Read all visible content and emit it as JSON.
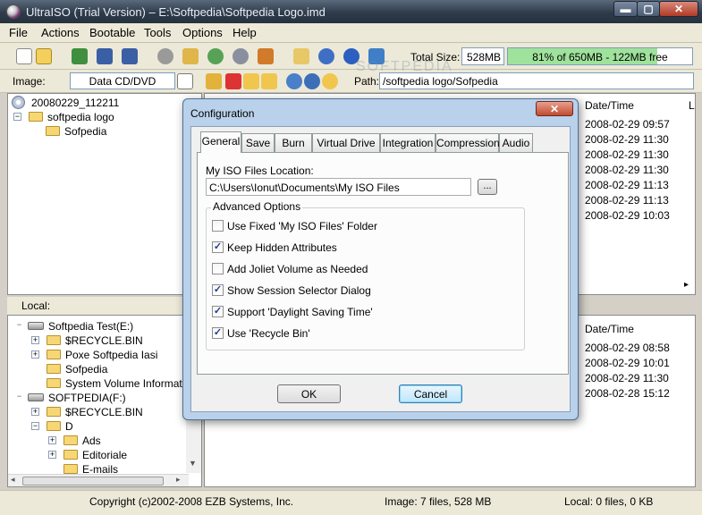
{
  "window": {
    "title": "UltraISO (Trial Version) – E:\\Softpedia\\Softpedia Logo.imd",
    "buttons": {
      "minimize": "▬",
      "maximize": "▢",
      "close": "✕"
    }
  },
  "menu": [
    "File",
    "Actions",
    "Bootable",
    "Tools",
    "Options",
    "Help"
  ],
  "toolbar": {
    "total_size_label": "Total Size:",
    "total_size_value": "528MB",
    "capacity_text": "81% of 650MB - 122MB free",
    "capacity_fraction": 0.81,
    "icons": [
      "new-icon",
      "open-icon",
      "extract-icon",
      "save-icon",
      "save-as-icon",
      "mount-icon",
      "burn-icon",
      "compress-icon",
      "virtual-drive-icon",
      "convert-icon",
      "properties-icon",
      "info-icon",
      "help-icon",
      "exit-icon"
    ]
  },
  "image_bar": {
    "image_label": "Image:",
    "image_type": "Data CD/DVD",
    "path_label": "Path:",
    "path_value": "/softpedia logo/Sofpedia"
  },
  "iso_tree": [
    "20080229_112211",
    "softpedia logo",
    "Sofpedia"
  ],
  "iso_list": {
    "header": "Date/Time",
    "header_extra": "L",
    "dates": [
      "2008-02-29 09:57",
      "2008-02-29 11:30",
      "2008-02-29 11:30",
      "2008-02-29 11:30",
      "2008-02-29 11:13",
      "2008-02-29 11:13",
      "2008-02-29 10:03"
    ]
  },
  "local": {
    "label": "Local:",
    "tree": [
      "Softpedia Test(E:)",
      "$RECYCLE.BIN",
      "Poxe Softpedia Iasi",
      "Sofpedia",
      "System Volume Information",
      "SOFTPEDIA(F:)",
      "$RECYCLE.BIN",
      "D",
      "Ads",
      "Editoriale",
      "E-mails"
    ],
    "list_header": "Date/Time",
    "dates": [
      "2008-02-29 08:58",
      "2008-02-29 10:01",
      "2008-02-29 11:30",
      "2008-02-28 15:12"
    ]
  },
  "status": {
    "copyright": "Copyright (c)2002-2008 EZB Systems, Inc.",
    "image_info": "Image: 7 files, 528 MB",
    "local_info": "Local: 0 files, 0 KB"
  },
  "dialog": {
    "title": "Configuration",
    "close": "✕",
    "tabs": [
      "General",
      "Save",
      "Burn",
      "Virtual Drive",
      "Integration",
      "Compression",
      "Audio"
    ],
    "active_tab": "General",
    "iso_location_label": "My ISO Files Location:",
    "iso_location_value": "C:\\Users\\Ionut\\Documents\\My ISO Files",
    "browse_label": "...",
    "advanced_label": "Advanced Options",
    "options": [
      {
        "label": "Use Fixed 'My ISO Files' Folder",
        "checked": false
      },
      {
        "label": "Keep Hidden Attributes",
        "checked": true
      },
      {
        "label": "Add Joliet Volume as Needed",
        "checked": false
      },
      {
        "label": "Show Session Selector Dialog",
        "checked": true
      },
      {
        "label": "Support 'Daylight Saving Time'",
        "checked": true
      },
      {
        "label": "Use 'Recycle Bin'",
        "checked": true
      }
    ],
    "ok_label": "OK",
    "cancel_label": "Cancel"
  },
  "watermark": "SOFTPEDIA",
  "colors": {
    "capacity_fill": "#9fe29c",
    "dialog_frame": "#b9d1ea",
    "title_bar": "#2e3b4a"
  }
}
